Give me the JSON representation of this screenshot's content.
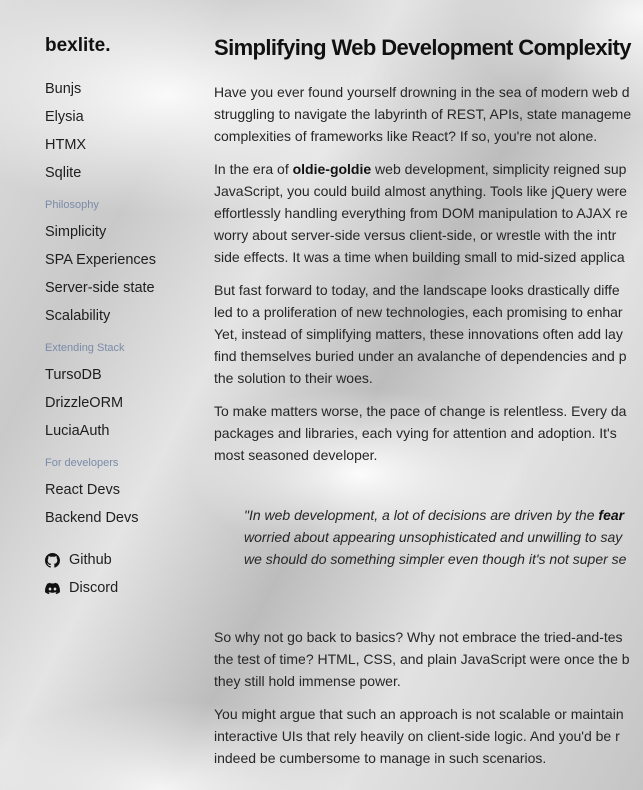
{
  "sidebar": {
    "logo": "bexlite.",
    "stack_items": [
      "Bunjs",
      "Elysia",
      "HTMX",
      "Sqlite"
    ],
    "sections": [
      {
        "title": "Philosophy",
        "items": [
          "Simplicity",
          "SPA Experiences",
          "Server-side state",
          "Scalability"
        ]
      },
      {
        "title": "Extending Stack",
        "items": [
          "TursoDB",
          "DrizzleORM",
          "LuciaAuth"
        ]
      },
      {
        "title": "For developers",
        "items": [
          "React Devs",
          "Backend Devs"
        ]
      }
    ],
    "social": [
      {
        "icon": "github-icon",
        "label": "Github"
      },
      {
        "icon": "discord-icon",
        "label": "Discord"
      }
    ]
  },
  "main": {
    "title": "Simplifying Web Development Complexity",
    "p1": [
      "Have you ever found yourself drowning in the sea of modern web d",
      "struggling to navigate the labyrinth of REST, APIs, state manageme",
      "complexities of frameworks like React? If so, you're not alone."
    ],
    "p2_prefix": "In the era of ",
    "p2_bold": "oldie-goldie",
    "p2_line1_rest": " web development, simplicity reigned sup",
    "p2_rest": [
      "JavaScript, you could build almost anything. Tools like jQuery were",
      "effortlessly handling everything from DOM manipulation to AJAX re",
      "worry about server-side versus client-side, or wrestle with the intr",
      "side effects. It was a time when building small to mid-sized applica"
    ],
    "p3": [
      "But fast forward to today, and the landscape looks drastically diffe",
      "led to a proliferation of new technologies, each promising to enhar",
      "Yet, instead of simplifying matters, these innovations often add lay",
      "find themselves buried under an avalanche of dependencies and p",
      "the solution to their woes."
    ],
    "p4": [
      "To make matters worse, the pace of change is relentless. Every da",
      "packages and libraries, each vying for attention and adoption. It's",
      "most seasoned developer."
    ],
    "quote_prefix": "\"In web development, a lot of decisions are driven by the ",
    "quote_bold": "fear",
    "quote_rest": [
      "worried about appearing unsophisticated and unwilling to say",
      "we should do something simpler even though it's not super se"
    ],
    "p5": [
      "So why not go back to basics? Why not embrace the tried-and-tes",
      "the test of time? HTML, CSS, and plain JavaScript were once the b",
      "they still hold immense power."
    ],
    "p6": [
      "You might argue that such an approach is not scalable or maintain",
      "interactive UIs that rely heavily on client-side logic. And you'd be r",
      "indeed be cumbersome to manage in such scenarios."
    ]
  }
}
